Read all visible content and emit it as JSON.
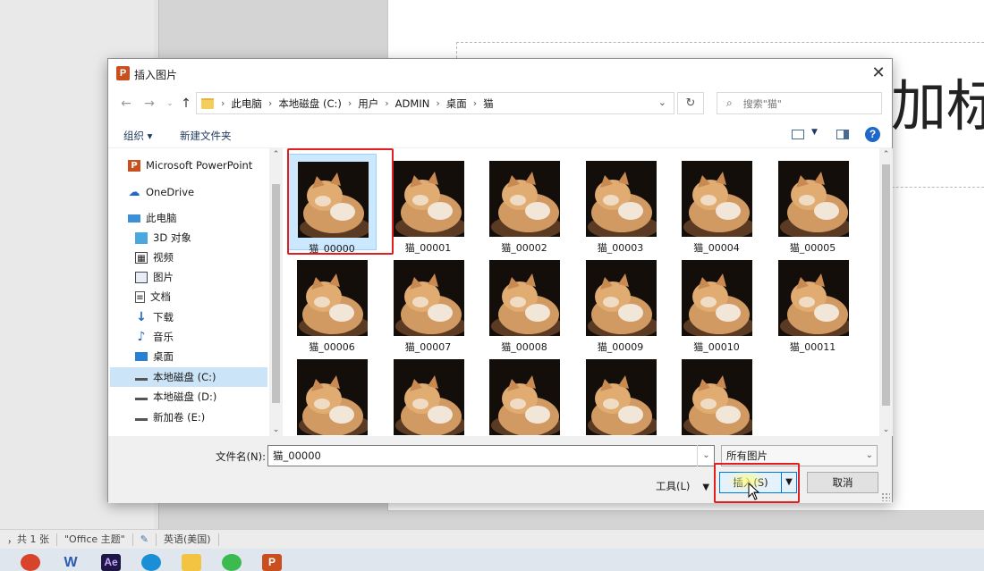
{
  "background": {
    "slide_title_fragment": "加标",
    "status_bar": [
      "，共 1 张",
      "\"Office 主题\"",
      "英语(美国)"
    ],
    "taskbar_apps": [
      {
        "name": "wps",
        "letter": "",
        "color": "#d8432b"
      },
      {
        "name": "word",
        "letter": "W",
        "color": "#2b5bb0"
      },
      {
        "name": "after-effects",
        "letter": "Ae",
        "color": "#1e1746"
      },
      {
        "name": "edge",
        "letter": "",
        "color": "#1b8fd6"
      },
      {
        "name": "file-explorer",
        "letter": "",
        "color": "#f3c442"
      },
      {
        "name": "wechat",
        "letter": "",
        "color": "#3dba4e"
      },
      {
        "name": "powerpoint",
        "letter": "P",
        "color": "#c94f1f"
      }
    ]
  },
  "dialog": {
    "title": "插入图片",
    "app_icon_letter": "P",
    "breadcrumb": [
      "此电脑",
      "本地磁盘 (C:)",
      "用户",
      "ADMIN",
      "桌面",
      "猫"
    ],
    "search_placeholder": "搜索\"猫\"",
    "toolbar": {
      "organize": "组织 ▾",
      "new_folder": "新建文件夹"
    },
    "nav_items": [
      {
        "label": "Microsoft PowerPoint",
        "icon": "powerpoint-icon",
        "selected": false
      },
      {
        "label": "OneDrive",
        "icon": "cloud-icon",
        "selected": false
      },
      {
        "label": "此电脑",
        "icon": "computer-icon",
        "selected": false
      },
      {
        "label": "3D 对象",
        "icon": "cube-icon",
        "selected": false
      },
      {
        "label": "视频",
        "icon": "video-icon",
        "selected": false
      },
      {
        "label": "图片",
        "icon": "picture-icon",
        "selected": false
      },
      {
        "label": "文档",
        "icon": "document-icon",
        "selected": false
      },
      {
        "label": "下载",
        "icon": "download-icon",
        "selected": false
      },
      {
        "label": "音乐",
        "icon": "music-icon",
        "selected": false
      },
      {
        "label": "桌面",
        "icon": "desktop-icon",
        "selected": false
      },
      {
        "label": "本地磁盘 (C:)",
        "icon": "drive-icon",
        "selected": true
      },
      {
        "label": "本地磁盘 (D:)",
        "icon": "drive-icon",
        "selected": false
      },
      {
        "label": "新加卷 (E:)",
        "icon": "drive-icon",
        "selected": false
      }
    ],
    "files": [
      {
        "name": "猫_00000",
        "selected": true
      },
      {
        "name": "猫_00001",
        "selected": false
      },
      {
        "name": "猫_00002",
        "selected": false
      },
      {
        "name": "猫_00003",
        "selected": false
      },
      {
        "name": "猫_00004",
        "selected": false
      },
      {
        "name": "猫_00005",
        "selected": false
      },
      {
        "name": "猫_00006",
        "selected": false
      },
      {
        "name": "猫_00007",
        "selected": false
      },
      {
        "name": "猫_00008",
        "selected": false
      },
      {
        "name": "猫_00009",
        "selected": false
      },
      {
        "name": "猫_00010",
        "selected": false
      },
      {
        "name": "猫_00011",
        "selected": false
      },
      {
        "name": "",
        "selected": false
      },
      {
        "name": "",
        "selected": false
      },
      {
        "name": "",
        "selected": false
      },
      {
        "name": "",
        "selected": false
      },
      {
        "name": "",
        "selected": false
      }
    ],
    "filename_label": "文件名(N):",
    "filename_value": "猫_00000",
    "filter_value": "所有图片",
    "tools_label": "工具(L)",
    "insert_label": "插入(S)",
    "cancel_label": "取消"
  }
}
